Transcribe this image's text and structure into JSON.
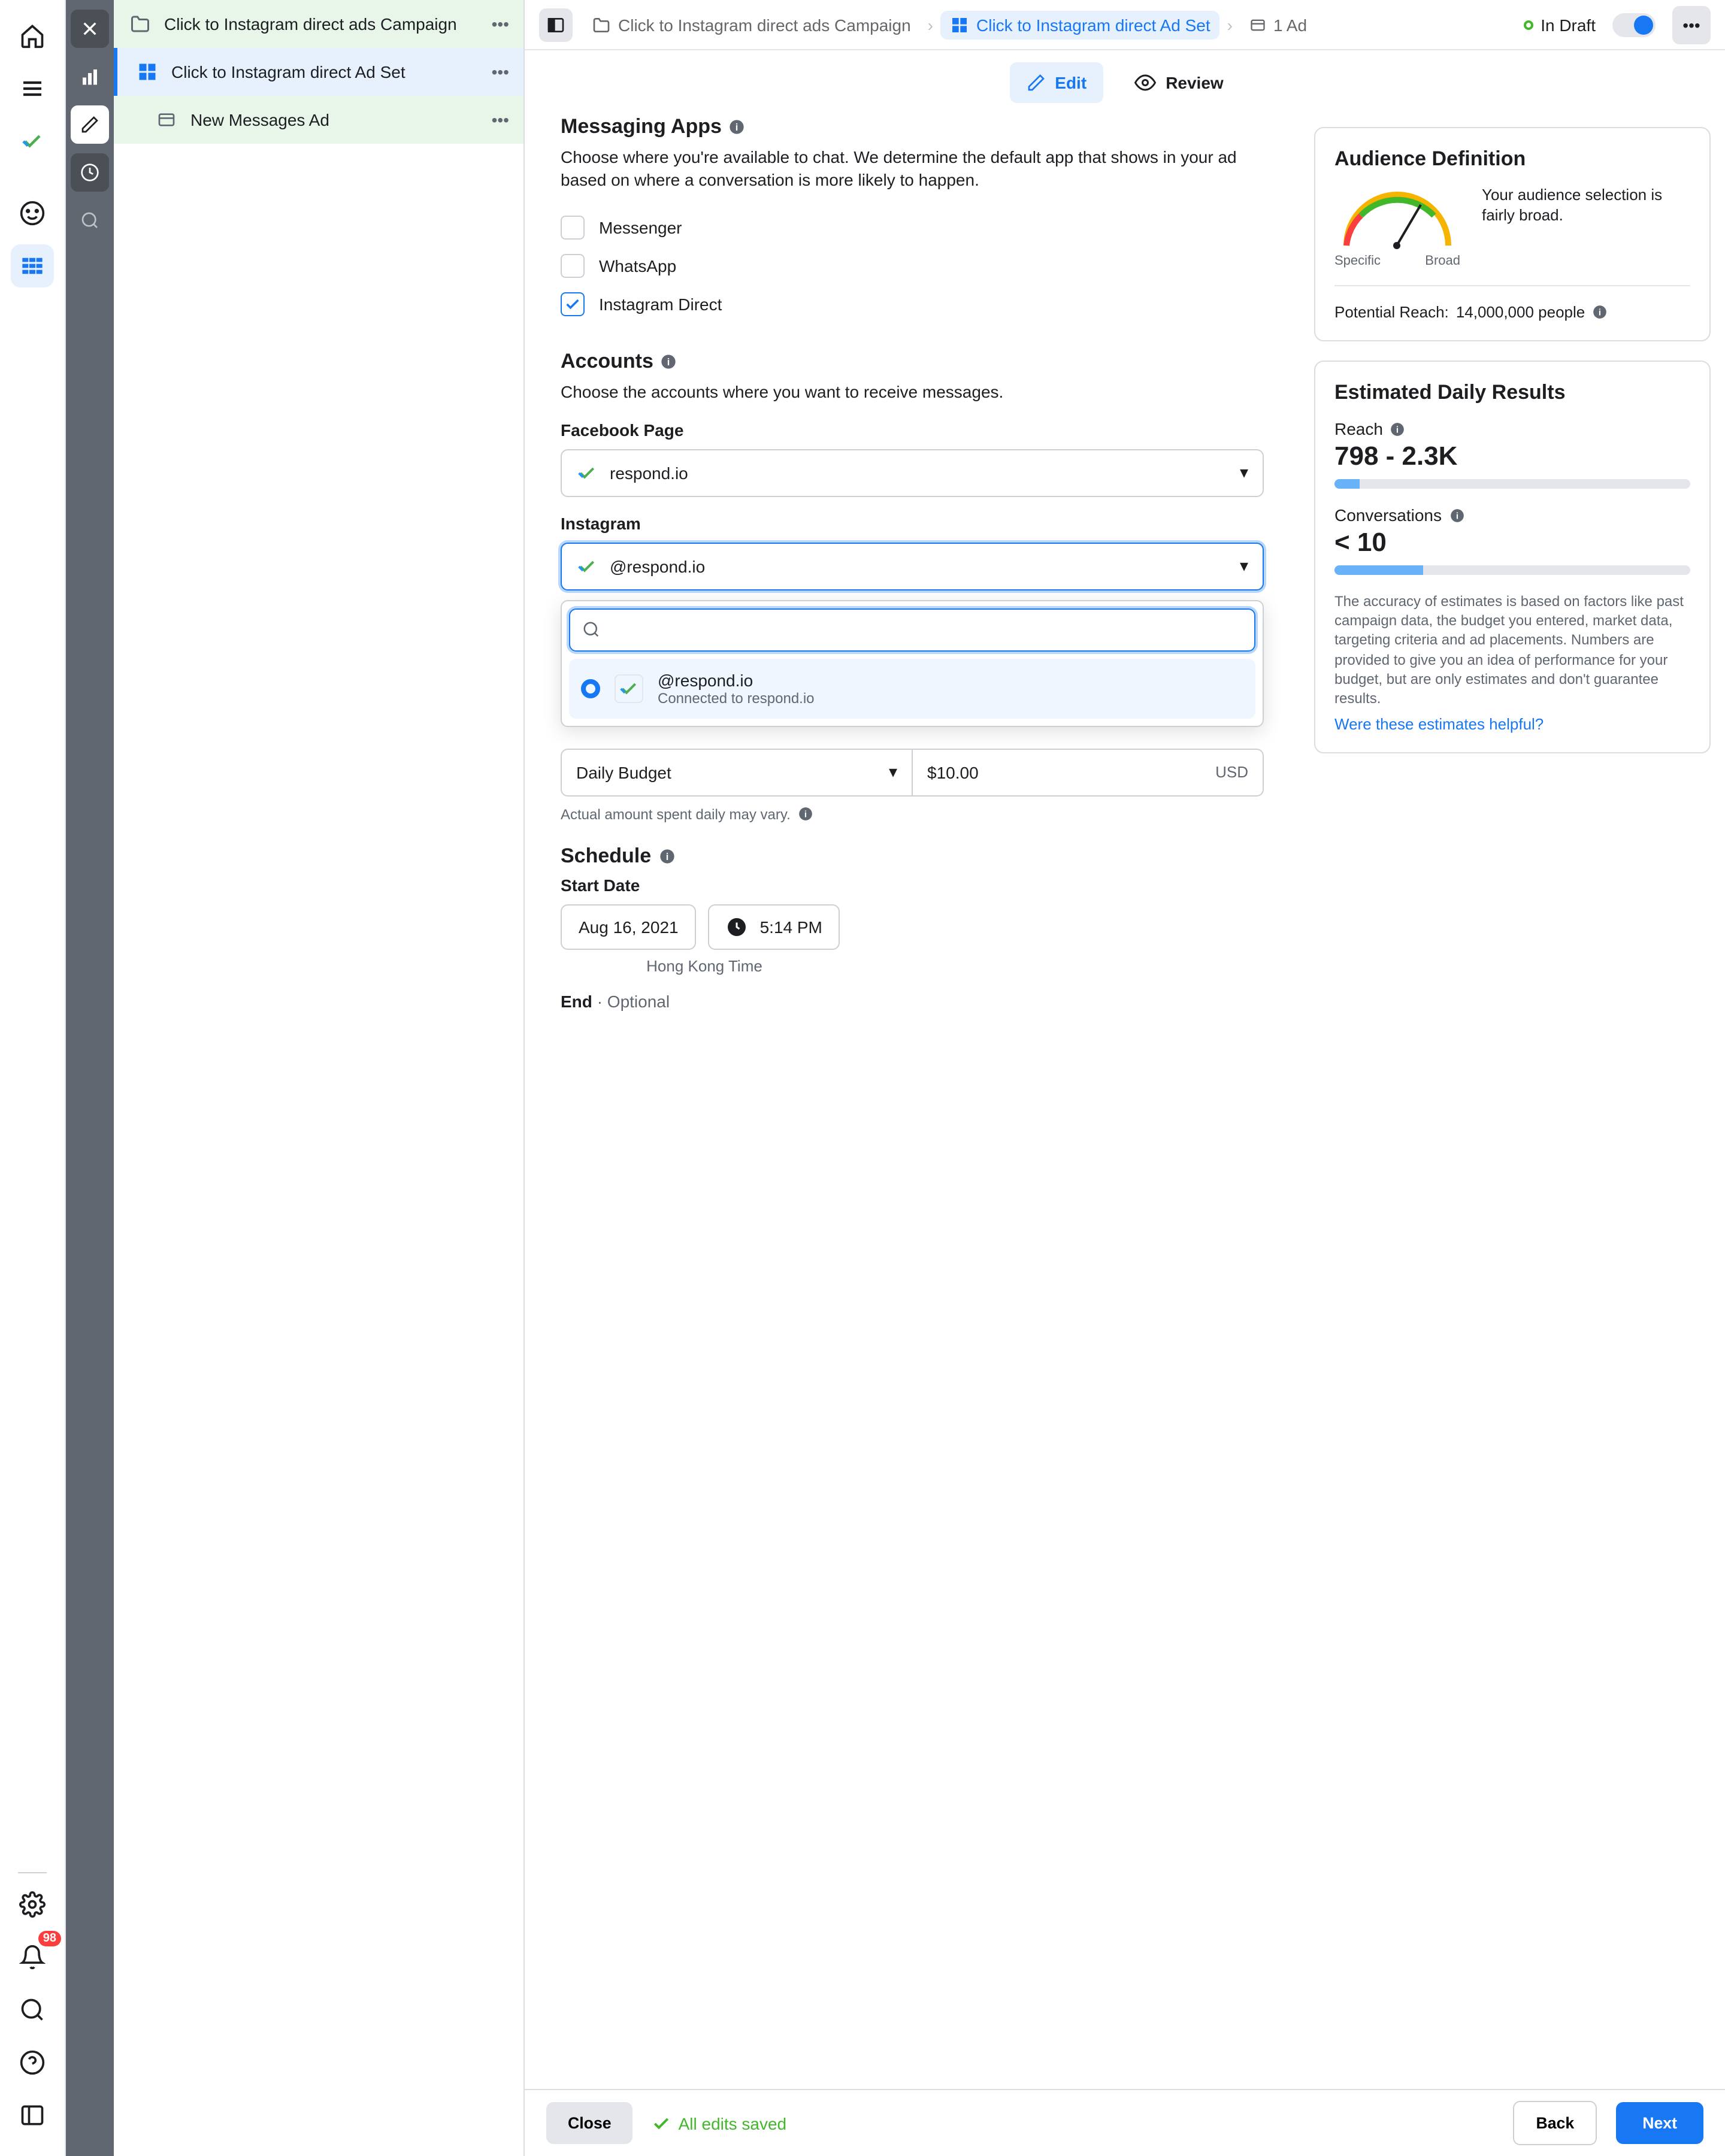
{
  "leftRail": {
    "notifCount": "98"
  },
  "tree": {
    "campaign": "Click to Instagram direct ads Campaign",
    "adset": "Click to Instagram direct Ad Set",
    "ad": "New Messages Ad"
  },
  "breadcrumbs": {
    "campaign": "Click to Instagram direct ads Campaign",
    "adset": "Click to Instagram direct Ad Set",
    "ad": "1 Ad"
  },
  "status": "In Draft",
  "tabs": {
    "edit": "Edit",
    "review": "Review"
  },
  "messaging": {
    "heading": "Messaging Apps",
    "desc": "Choose where you're available to chat. We determine the default app that shows in your ad based on where a conversation is more likely to happen.",
    "opts": {
      "messenger": "Messenger",
      "whatsapp": "WhatsApp",
      "instagram": "Instagram Direct"
    }
  },
  "accounts": {
    "heading": "Accounts",
    "desc": "Choose the accounts where you want to receive messages.",
    "fbLabel": "Facebook Page",
    "fbValue": "respond.io",
    "igLabel": "Instagram",
    "igValue": "@respond.io",
    "ddHandle": "@respond.io",
    "ddSub": "Connected to respond.io"
  },
  "budget": {
    "type": "Daily Budget",
    "amount": "$10.00",
    "currency": "USD",
    "hint": "Actual amount spent daily may vary."
  },
  "schedule": {
    "heading": "Schedule",
    "startLabel": "Start Date",
    "startDate": "Aug 16, 2021",
    "startTime": "5:14 PM",
    "tz": "Hong Kong Time",
    "end": "End",
    "optional": "· Optional"
  },
  "audience": {
    "heading": "Audience Definition",
    "text": "Your audience selection is fairly broad.",
    "specific": "Specific",
    "broad": "Broad",
    "reachLabel": "Potential Reach:",
    "reachValue": "14,000,000 people"
  },
  "daily": {
    "heading": "Estimated Daily Results",
    "reachLabel": "Reach",
    "reachValue": "798 - 2.3K",
    "convLabel": "Conversations",
    "convValue": "< 10",
    "disc": "The accuracy of estimates is based on factors like past campaign data, the budget you entered, market data, targeting criteria and ad placements. Numbers are provided to give you an idea of performance for your budget, but are only estimates and don't guarantee results.",
    "link": "Were these estimates helpful?"
  },
  "footer": {
    "close": "Close",
    "saved": "All edits saved",
    "back": "Back",
    "next": "Next"
  }
}
